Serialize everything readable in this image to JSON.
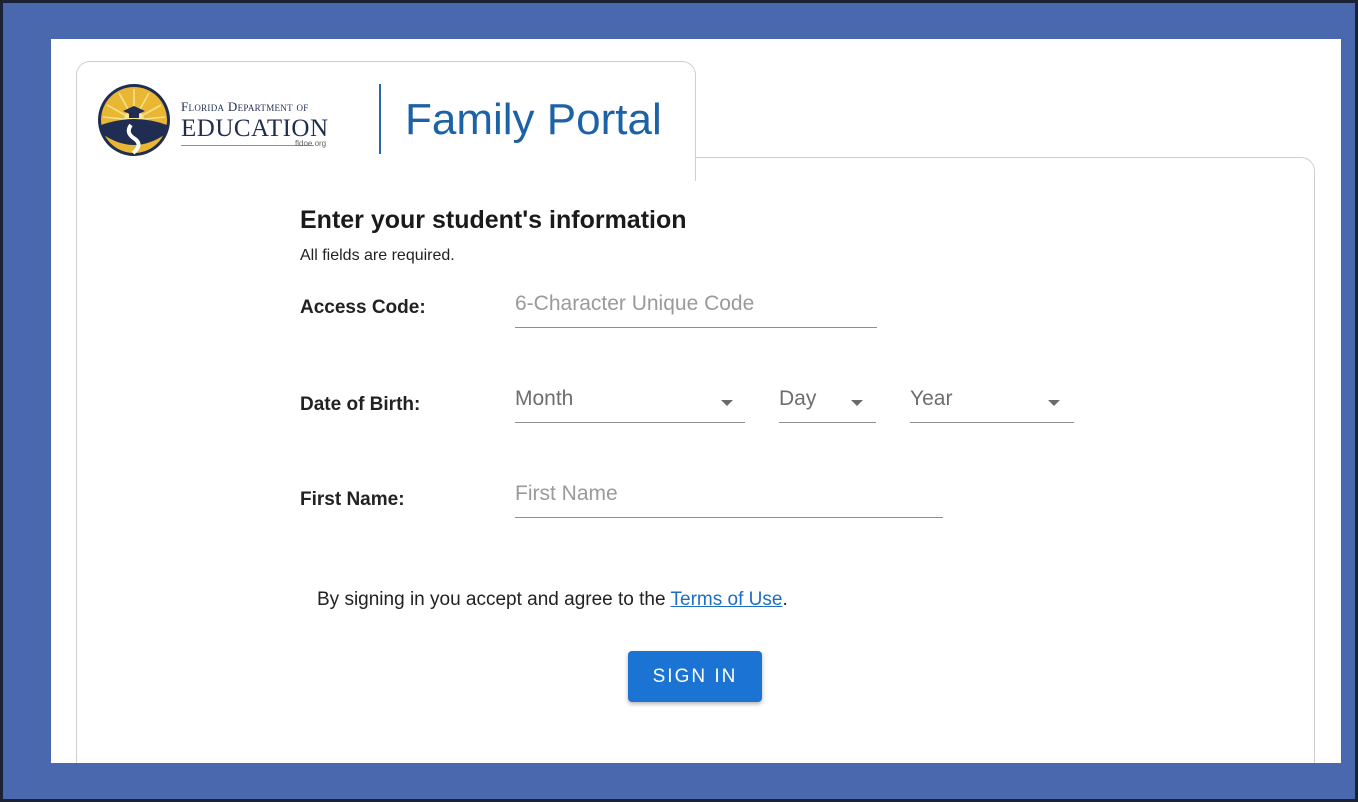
{
  "header": {
    "logo_line1": "Florida Department of",
    "logo_line2": "EDUCATION",
    "logo_site": "fldoe.org",
    "title": "Family Portal"
  },
  "form": {
    "heading": "Enter your student's information",
    "subheading": "All fields are required.",
    "access_code": {
      "label": "Access Code:",
      "placeholder": "6-Character Unique Code",
      "value": ""
    },
    "dob": {
      "label": "Date of Birth:",
      "month": "Month",
      "day": "Day",
      "year": "Year"
    },
    "first_name": {
      "label": "First Name:",
      "placeholder": "First Name",
      "value": ""
    },
    "terms_prefix": "By signing in you accept and agree to the ",
    "terms_link": "Terms of Use",
    "terms_suffix": ".",
    "submit_label": "SIGN IN"
  },
  "colors": {
    "page_background": "#4a68ae",
    "brand_blue": "#1c62a6",
    "button_blue": "#1b74d4",
    "link_blue": "#1d6ec4"
  }
}
